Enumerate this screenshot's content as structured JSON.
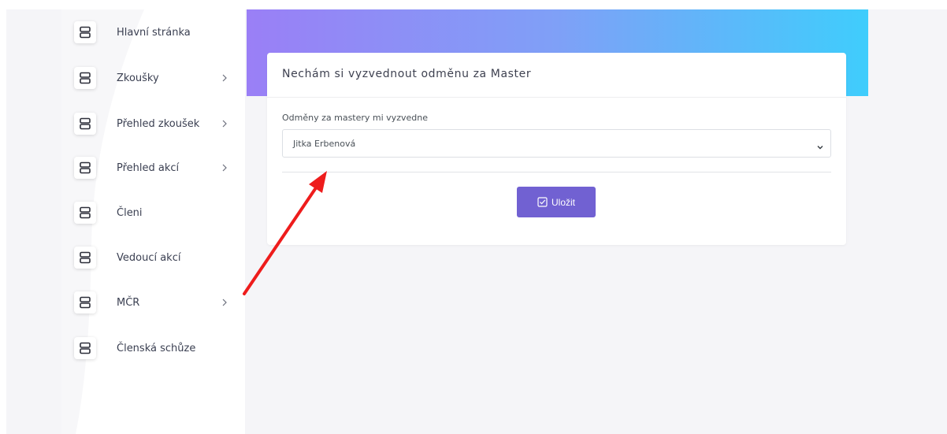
{
  "sidebar": {
    "items": [
      {
        "label": "Hlavní stránka",
        "icon": "server-icon",
        "has_submenu": false
      },
      {
        "label": "Zkoušky",
        "icon": "server-icon",
        "has_submenu": true
      },
      {
        "label": "Přehled zkoušek",
        "icon": "server-icon",
        "has_submenu": true
      },
      {
        "label": "Přehled akcí",
        "icon": "server-icon",
        "has_submenu": true
      },
      {
        "label": "Členi",
        "icon": "server-icon",
        "has_submenu": false
      },
      {
        "label": "Vedoucí akcí",
        "icon": "server-icon",
        "has_submenu": false
      },
      {
        "label": "MČR",
        "icon": "server-icon",
        "has_submenu": true
      },
      {
        "label": "Členská schůze",
        "icon": "server-icon",
        "has_submenu": false
      }
    ]
  },
  "card": {
    "title": "Nechám si vyzvednout odměnu za Master",
    "field_label": "Odměny za mastery mi vyzvedne",
    "select_value": "Jitka Erbenová",
    "save_label": "Uložit"
  },
  "colors": {
    "hero_start": "#9a7ff6",
    "hero_end": "#3fcdfc",
    "button": "#7161d2",
    "annotation_arrow": "#ee1c1c"
  }
}
